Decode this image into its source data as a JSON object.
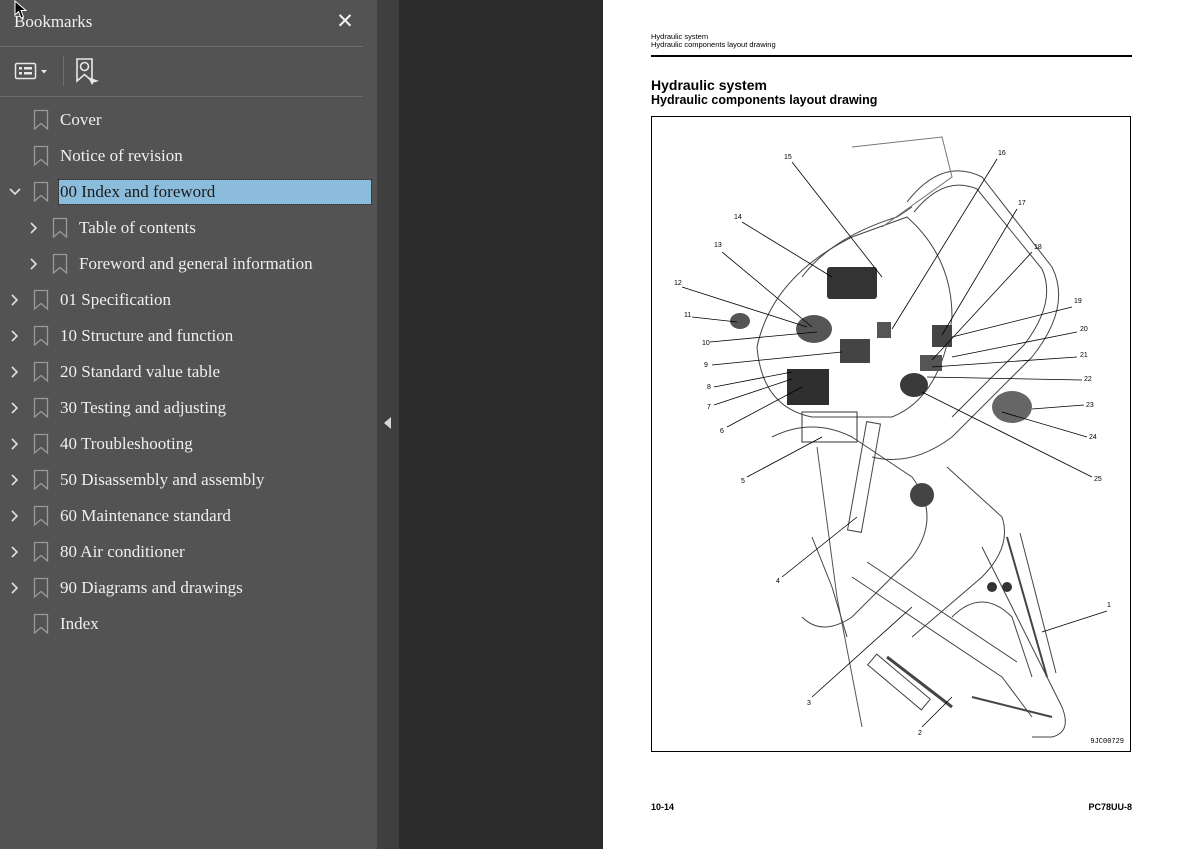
{
  "sidebar": {
    "title": "Bookmarks",
    "close_label": "✕",
    "toolbar": {
      "options_icon": "list-options-icon",
      "find_icon": "find-bookmark-icon"
    },
    "items": [
      {
        "label": "Cover",
        "chevron": "none",
        "indent": 0
      },
      {
        "label": "Notice of revision",
        "chevron": "none",
        "indent": 0
      },
      {
        "label": "00 Index and foreword",
        "chevron": "expanded",
        "indent": 0,
        "selected": true
      },
      {
        "label": "Table of contents",
        "chevron": "collapsed",
        "indent": 1
      },
      {
        "label": "Foreword and general information",
        "chevron": "collapsed",
        "indent": 1
      },
      {
        "label": "01 Specification",
        "chevron": "collapsed",
        "indent": 0
      },
      {
        "label": "10 Structure and function",
        "chevron": "collapsed",
        "indent": 0
      },
      {
        "label": "20 Standard value table",
        "chevron": "collapsed",
        "indent": 0
      },
      {
        "label": "30 Testing and adjusting",
        "chevron": "collapsed",
        "indent": 0
      },
      {
        "label": "40 Troubleshooting",
        "chevron": "collapsed",
        "indent": 0
      },
      {
        "label": "50 Disassembly and assembly",
        "chevron": "collapsed",
        "indent": 0
      },
      {
        "label": "60 Maintenance standard",
        "chevron": "collapsed",
        "indent": 0
      },
      {
        "label": "80 Air conditioner",
        "chevron": "collapsed",
        "indent": 0
      },
      {
        "label": "90 Diagrams and drawings",
        "chevron": "collapsed",
        "indent": 0
      },
      {
        "label": "Index",
        "chevron": "none",
        "indent": 0
      }
    ]
  },
  "page": {
    "running_head_line1": "Hydraulic system",
    "running_head_line2": "Hydraulic components layout drawing",
    "section_title": "Hydraulic system",
    "section_subtitle": "Hydraulic components layout drawing",
    "figure_code": "9JC00729",
    "page_number": "10-14",
    "model": "PC78UU-8",
    "callouts": [
      "1",
      "2",
      "3",
      "4",
      "5",
      "6",
      "7",
      "8",
      "9",
      "10",
      "11",
      "12",
      "13",
      "14",
      "15",
      "16",
      "17",
      "18",
      "19",
      "20",
      "21",
      "22",
      "23",
      "24",
      "25"
    ]
  },
  "colors": {
    "sidebar_bg": "#535353",
    "selected_bg": "#8cbcdc",
    "viewer_bg": "#2b2b2b"
  }
}
